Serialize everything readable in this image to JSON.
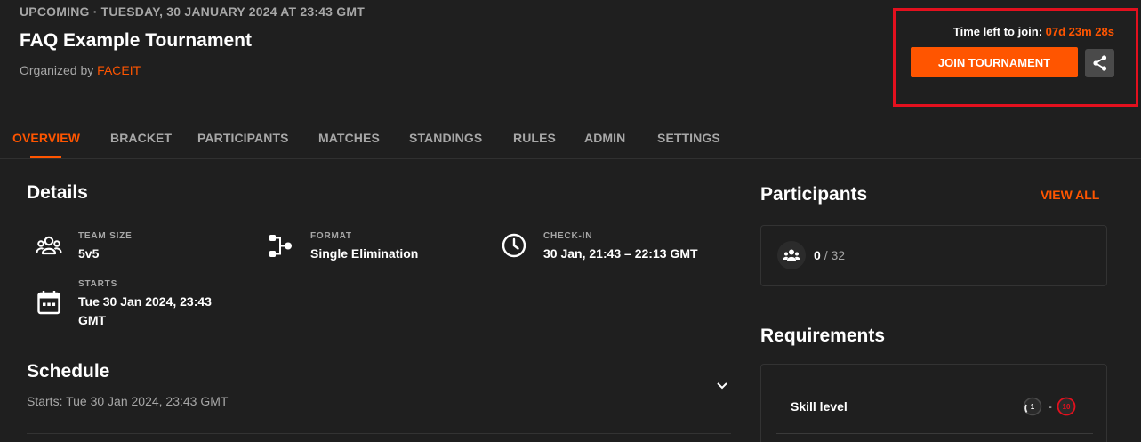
{
  "header": {
    "status_line": "UPCOMING · TUESDAY, 30 JANUARY 2024 AT 23:43 GMT",
    "title": "FAQ Example Tournament",
    "organized_by_label": "Organized by",
    "organizer": "FACEIT",
    "time_left_label": "Time left to join:",
    "countdown": "07d 23m 28s",
    "join_label": "JOIN TOURNAMENT",
    "share_icon": "share-icon"
  },
  "tabs": [
    {
      "label": "OVERVIEW",
      "active": true
    },
    {
      "label": "BRACKET"
    },
    {
      "label": "PARTICIPANTS"
    },
    {
      "label": "MATCHES"
    },
    {
      "label": "STANDINGS"
    },
    {
      "label": "RULES"
    },
    {
      "label": "ADMIN"
    },
    {
      "label": "SETTINGS"
    }
  ],
  "details": {
    "title": "Details",
    "team_size": {
      "label": "TEAM SIZE",
      "value": "5v5",
      "icon": "team-icon"
    },
    "format": {
      "label": "FORMAT",
      "value": "Single Elimination",
      "icon": "bracket-format-icon"
    },
    "checkin": {
      "label": "CHECK-IN",
      "value": "30 Jan, 21:43 – 22:13 GMT",
      "icon": "clock-icon"
    },
    "starts": {
      "label": "STARTS",
      "value_line1": "Tue 30 Jan 2024, 23:43",
      "value_line2": "GMT",
      "icon": "calendar-icon"
    }
  },
  "schedule": {
    "title": "Schedule",
    "starts_text": "Starts: Tue 30 Jan 2024, 23:43 GMT"
  },
  "participants": {
    "title": "Participants",
    "view_all": "VIEW ALL",
    "current": "0",
    "separator": "/ 32"
  },
  "requirements": {
    "title": "Requirements",
    "skill_label": "Skill level",
    "skill_min": "1",
    "skill_sep": "-",
    "skill_max": "10"
  },
  "colors": {
    "accent": "#ff5500",
    "background": "#1f1f1f",
    "highlight_border": "#e3101e",
    "muted_text": "#a7a7a7"
  }
}
